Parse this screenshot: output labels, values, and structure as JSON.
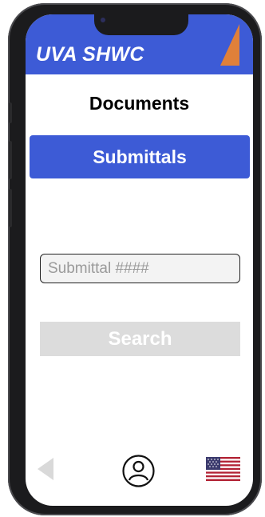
{
  "header": {
    "title": "UVA SHWC",
    "logo_icon": "orange-triangle-logo",
    "color": "#3d5bd6"
  },
  "page": {
    "title": "Documents"
  },
  "section_button": {
    "label": "Submittals"
  },
  "search": {
    "placeholder": "Submittal ####",
    "value": "",
    "button_label": "Search"
  },
  "bottom_nav": {
    "back_icon": "back-arrow-icon",
    "profile_icon": "user-profile-icon",
    "language_icon": "us-flag-icon"
  },
  "colors": {
    "accent": "#3d5bd6",
    "logo": "#e0803a",
    "disabled_button": "#dcdcdc"
  }
}
